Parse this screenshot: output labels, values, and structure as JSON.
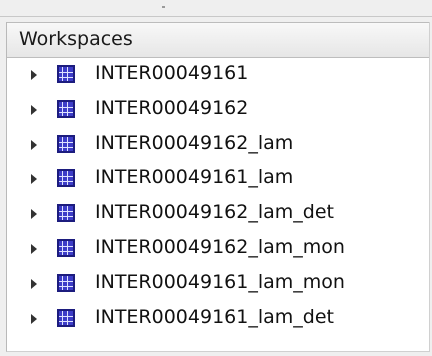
{
  "panel": {
    "header": "Workspaces"
  },
  "workspaces": [
    {
      "name": "INTER00049161"
    },
    {
      "name": "INTER00049162"
    },
    {
      "name": "INTER00049162_lam"
    },
    {
      "name": "INTER00049161_lam"
    },
    {
      "name": "INTER00049162_lam_det"
    },
    {
      "name": "INTER00049162_lam_mon"
    },
    {
      "name": "INTER00049161_lam_mon"
    },
    {
      "name": "INTER00049161_lam_det"
    }
  ],
  "icons": {
    "expand": "expand-arrow-icon",
    "workspace": "workspace-icon"
  }
}
